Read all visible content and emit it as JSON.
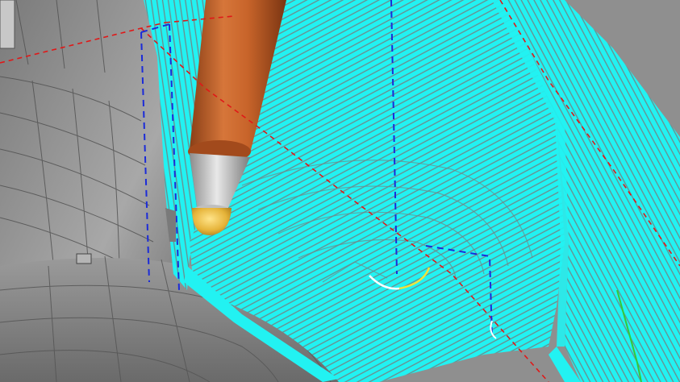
{
  "viewport": {
    "description_label": ""
  },
  "colors": {
    "background_gray": "#8e8e8e",
    "part_surface_light": "#bdbdbd",
    "part_surface_dark": "#6a6a6a",
    "mesh_edges": "#4a4a4a",
    "toolpath_cyan": "#22f2f2",
    "toolpath_gap": "#6e8a8a",
    "holder_orange": "#c8642a",
    "holder_shadow": "#8a3f17",
    "collet_silver": "#c9c9c9",
    "ball_tip_gold": "#e6b43a",
    "boundary_red_dashed": "#e01818",
    "boundary_blue_dashed": "#1b2bd8",
    "leadin_white": "#ffffff",
    "leadin_yellow": "#f2e23a",
    "leadin_green": "#35c83a"
  },
  "objects": {
    "tool": "ball-nose-tool",
    "toolpath": "raster-and-offset-toolpath",
    "workpiece": "cad-part-surface"
  }
}
